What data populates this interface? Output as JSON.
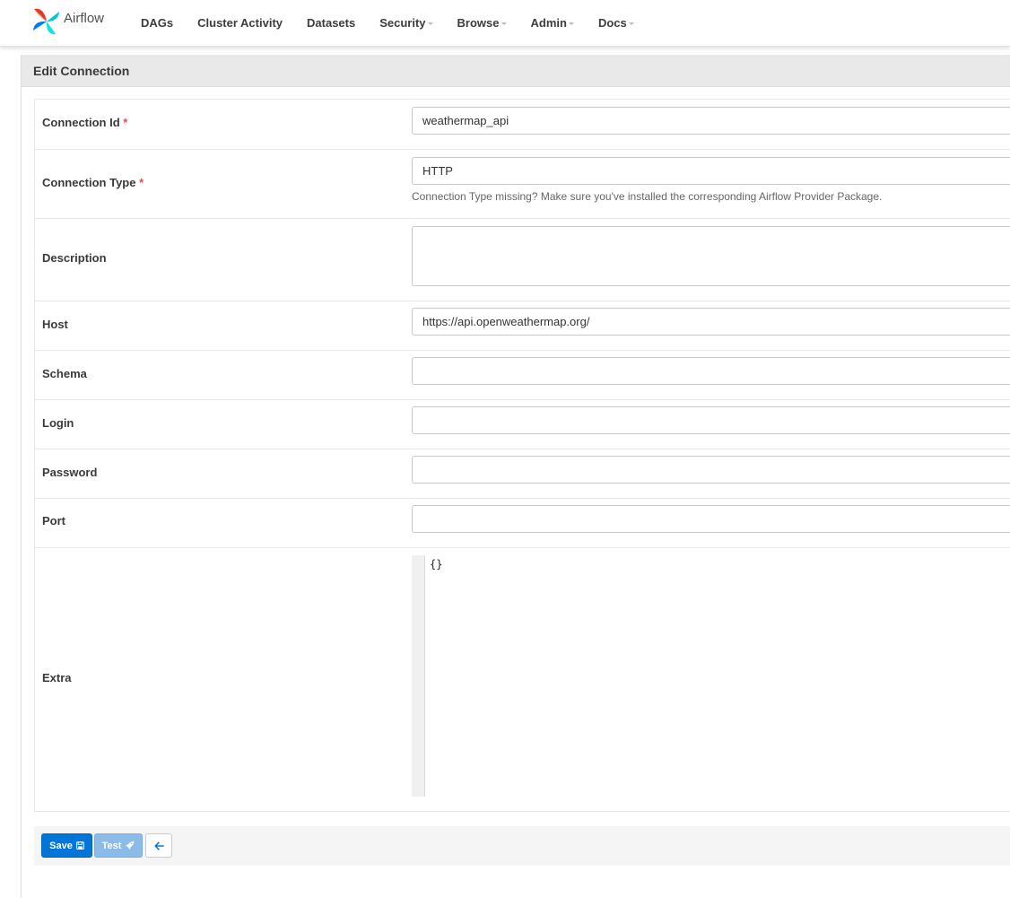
{
  "navbar": {
    "brand": "Airflow",
    "items": [
      {
        "label": "DAGs",
        "dropdown": false
      },
      {
        "label": "Cluster Activity",
        "dropdown": false
      },
      {
        "label": "Datasets",
        "dropdown": false
      },
      {
        "label": "Security",
        "dropdown": true
      },
      {
        "label": "Browse",
        "dropdown": true
      },
      {
        "label": "Admin",
        "dropdown": true
      },
      {
        "label": "Docs",
        "dropdown": true
      }
    ]
  },
  "panel": {
    "title": "Edit Connection"
  },
  "form": {
    "required_marker": "*",
    "connection_id": {
      "label": "Connection Id",
      "value": "weathermap_api"
    },
    "connection_type": {
      "label": "Connection Type",
      "value": "HTTP",
      "help": "Connection Type missing? Make sure you've installed the corresponding Airflow Provider Package."
    },
    "description": {
      "label": "Description",
      "value": ""
    },
    "host": {
      "label": "Host",
      "value": "https://api.openweathermap.org/"
    },
    "schema": {
      "label": "Schema",
      "value": ""
    },
    "login": {
      "label": "Login",
      "value": ""
    },
    "password": {
      "label": "Password",
      "value": ""
    },
    "port": {
      "label": "Port",
      "value": ""
    },
    "extra": {
      "label": "Extra",
      "value": "{}"
    }
  },
  "actions": {
    "save_label": "Save",
    "test_label": "Test"
  },
  "colors": {
    "primary": "#0275d8",
    "required": "#d9534f"
  }
}
